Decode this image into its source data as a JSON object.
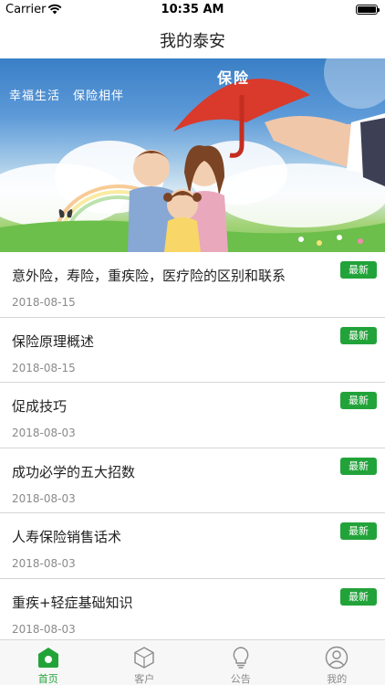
{
  "status_bar": {
    "carrier": "Carrier",
    "time": "10:35 AM"
  },
  "nav": {
    "title": "我的泰安"
  },
  "banner": {
    "slogan": "幸福生活　保险相伴",
    "umbrella_label": "保险"
  },
  "news": [
    {
      "title": "意外险，寿险，重疾险，医疗险的区别和联系",
      "date": "2018-08-15",
      "badge": "最新"
    },
    {
      "title": "保险原理概述",
      "date": "2018-08-15",
      "badge": "最新"
    },
    {
      "title": "促成技巧",
      "date": "2018-08-03",
      "badge": "最新"
    },
    {
      "title": "成功必学的五大招数",
      "date": "2018-08-03",
      "badge": "最新"
    },
    {
      "title": "人寿保险销售话术",
      "date": "2018-08-03",
      "badge": "最新"
    },
    {
      "title": "重疾+轻症基础知识",
      "date": "2018-08-03",
      "badge": "最新"
    }
  ],
  "tabs": [
    {
      "label": "首页",
      "icon": "home-icon",
      "active": true
    },
    {
      "label": "客户",
      "icon": "hexagon-icon",
      "active": false
    },
    {
      "label": "公告",
      "icon": "lightbulb-icon",
      "active": false
    },
    {
      "label": "我的",
      "icon": "user-icon",
      "active": false
    }
  ],
  "colors": {
    "accent": "#22a33a",
    "badge": "#22a33a",
    "umbrella": "#d93a2b"
  }
}
